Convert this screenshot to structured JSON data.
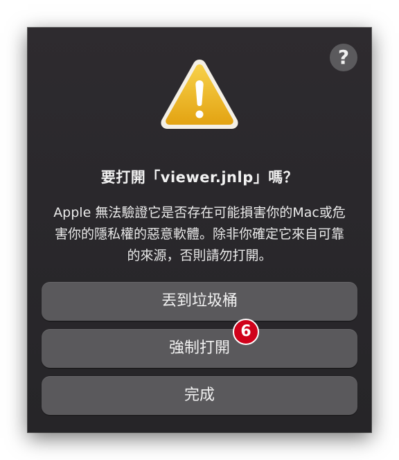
{
  "dialog": {
    "help_label": "?",
    "title": "要打開「viewer.jnlp」嗎？",
    "message": "Apple 無法驗證它是否存在可能損害你的Mac或危害你的隱私權的惡意軟體。除非你確定它來自可靠的來源，否則請勿打開。",
    "icon": "warning-triangle-icon",
    "buttons": {
      "trash": "丟到垃圾桶",
      "force_open": "強制打開",
      "done": "完成"
    }
  },
  "annotation": {
    "step_number": "6",
    "color": "#d0021b"
  }
}
